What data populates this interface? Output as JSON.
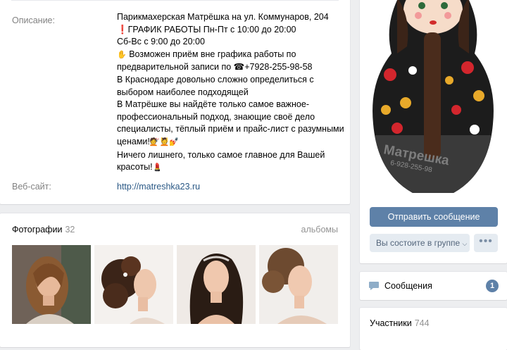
{
  "info": {
    "description_label": "Описание:",
    "description_lines": [
      "Парикмахерская Матрёшка на ул. Коммунаров, 204",
      "❗ГРАФИК РАБОТЫ Пн-Пт с 10:00 до 20:00",
      "Сб-Вс с 9:00 до 20:00",
      "Возможен приём вне графика работы по",
      "предварительной записи по ☎+7928-255-98-58",
      "В Краснодаре довольно сложно определиться с",
      "выбором наиболее подходящей",
      "В Матрёшке вы найдёте только самое важное-",
      "профессиональный подход, знающие своё дело",
      "специалисты, тёплый приём и прайс-лист с разумными",
      "ценами!",
      "Ничего лишнего, только самое главное для Вашей",
      "красоты!"
    ],
    "website_label": "Веб-сайт:",
    "website_url": "http://matreshka23.ru"
  },
  "photos": {
    "title": "Фотографии",
    "count": "32",
    "albums_link": "альбомы",
    "items": [
      "photo-1",
      "photo-2",
      "photo-3",
      "photo-4"
    ]
  },
  "sidebar": {
    "avatar_text": "Матрешка",
    "avatar_phone": "6-928-255-98",
    "send_message_button": "Отправить сообщение",
    "member_status_button": "Вы состоите в группе",
    "more_button": "•••",
    "messages_label": "Сообщения",
    "messages_count": "1",
    "members_label": "Участники",
    "members_count": "744"
  },
  "colors": {
    "accent": "#5e81a8",
    "link": "#2a5885",
    "background": "#edeef0"
  }
}
